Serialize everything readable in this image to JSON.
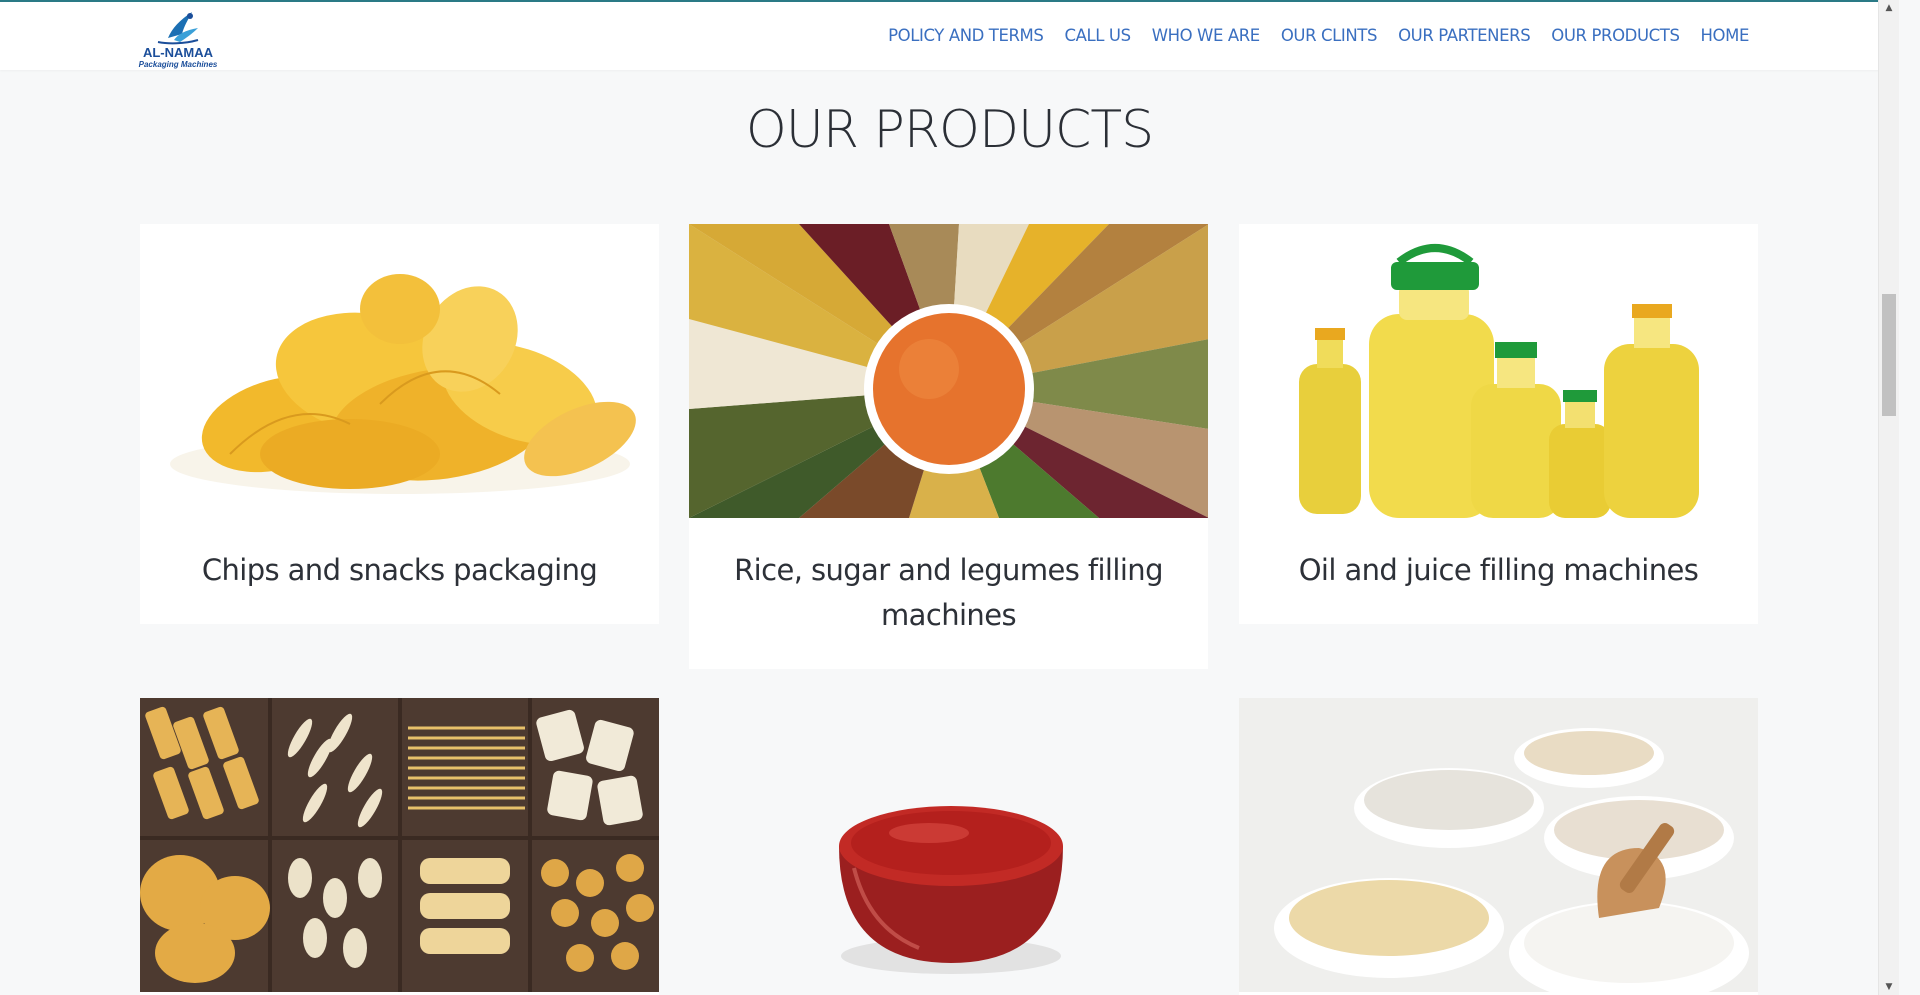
{
  "brand": {
    "name": "AL-NAMAA",
    "tagline": "Packaging Machines"
  },
  "nav": {
    "items": [
      {
        "label": "POLICY AND TERMS"
      },
      {
        "label": "CALL US"
      },
      {
        "label": "WHO WE ARE"
      },
      {
        "label": "OUR CLINTS"
      },
      {
        "label": "OUR PARTENERS"
      },
      {
        "label": "OUR PRODUCTS"
      },
      {
        "label": "HOME"
      }
    ]
  },
  "products_section": {
    "title": "OUR PRODUCTS",
    "cards": [
      {
        "caption": "Chips and snacks packaging",
        "image": "potato-chips-image"
      },
      {
        "caption": "Rice, sugar and legumes filling machines",
        "image": "grains-legumes-image"
      },
      {
        "caption": "Oil and juice filling machines",
        "image": "oil-bottles-image"
      },
      {
        "caption": "",
        "image": "pasta-varieties-image"
      },
      {
        "caption": "",
        "image": "ketchup-bowl-image"
      },
      {
        "caption": "",
        "image": "flour-bowls-image"
      }
    ]
  },
  "colors": {
    "nav_link": "#3a6fc0",
    "page_background": "#f7f8f9",
    "card_background": "#ffffff",
    "title_text": "#2b2f36",
    "top_border": "#2a7a86"
  }
}
